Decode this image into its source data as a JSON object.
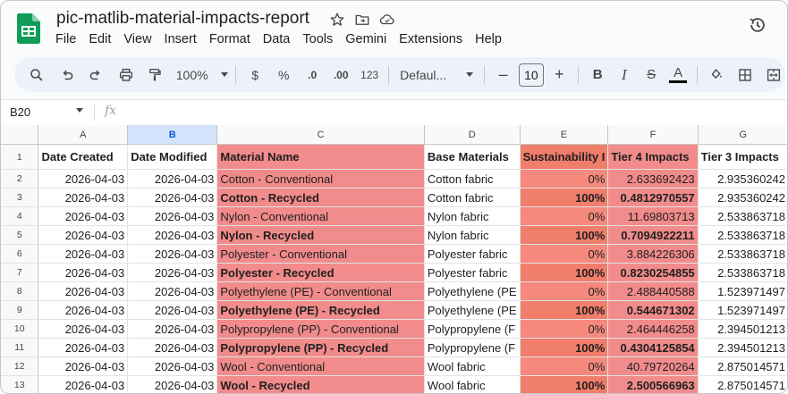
{
  "document": {
    "title": "pic-matlib-material-impacts-report"
  },
  "menu": [
    "File",
    "Edit",
    "View",
    "Insert",
    "Format",
    "Data",
    "Tools",
    "Gemini",
    "Extensions",
    "Help"
  ],
  "toolbar": {
    "zoom": "100%",
    "currency": "$",
    "percent": "%",
    "decrease_decimals": ".0",
    "increase_decimals": ".00",
    "number_format": "123",
    "font": "Defaul...",
    "font_size": "10",
    "minus": "–",
    "plus": "+",
    "bold": "B",
    "italic": "I",
    "strike": "S",
    "text_color": "A"
  },
  "formula_bar": {
    "cell_ref": "B20",
    "fx": "fx"
  },
  "columns": [
    "A",
    "B",
    "C",
    "D",
    "E",
    "F",
    "G"
  ],
  "header_row": {
    "number": "1",
    "cells": [
      "Date Created",
      "Date Modified",
      "Material Name",
      "Base Materials",
      "Sustainability I",
      "Tier 4 Impacts",
      "Tier 3 Impacts"
    ]
  },
  "rows": [
    {
      "n": "2",
      "a": "2026-04-03",
      "b": "2026-04-03",
      "c": "Cotton - Conventional",
      "d": "Cotton fabric",
      "e": "0%",
      "f": "2.633692423",
      "g": "2.935360242",
      "bold": false
    },
    {
      "n": "3",
      "a": "2026-04-03",
      "b": "2026-04-03",
      "c": "Cotton - Recycled",
      "d": "Cotton fabric",
      "e": "100%",
      "f": "0.4812970557",
      "g": "2.935360242",
      "bold": true
    },
    {
      "n": "4",
      "a": "2026-04-03",
      "b": "2026-04-03",
      "c": "Nylon - Conventional",
      "d": "Nylon fabric",
      "e": "0%",
      "f": "11.69803713",
      "g": "2.533863718",
      "bold": false
    },
    {
      "n": "5",
      "a": "2026-04-03",
      "b": "2026-04-03",
      "c": "Nylon - Recycled",
      "d": "Nylon fabric",
      "e": "100%",
      "f": "0.7094922211",
      "g": "2.533863718",
      "bold": true
    },
    {
      "n": "6",
      "a": "2026-04-03",
      "b": "2026-04-03",
      "c": "Polyester - Conventional",
      "d": "Polyester fabric",
      "e": "0%",
      "f": "3.884226306",
      "g": "2.533863718",
      "bold": false
    },
    {
      "n": "7",
      "a": "2026-04-03",
      "b": "2026-04-03",
      "c": "Polyester - Recycled",
      "d": "Polyester fabric",
      "e": "100%",
      "f": "0.8230254855",
      "g": "2.533863718",
      "bold": true
    },
    {
      "n": "8",
      "a": "2026-04-03",
      "b": "2026-04-03",
      "c": "Polyethylene (PE) - Conventional",
      "d": "Polyethylene (PE",
      "e": "0%",
      "f": "2.488440588",
      "g": "1.523971497",
      "bold": false
    },
    {
      "n": "9",
      "a": "2026-04-03",
      "b": "2026-04-03",
      "c": "Polyethylene (PE) - Recycled",
      "d": "Polyethylene (PE",
      "e": "100%",
      "f": "0.544671302",
      "g": "1.523971497",
      "bold": true
    },
    {
      "n": "10",
      "a": "2026-04-03",
      "b": "2026-04-03",
      "c": "Polypropylene (PP) - Conventional",
      "d": "Polypropylene (F",
      "e": "0%",
      "f": "2.464446258",
      "g": "2.394501213",
      "bold": false
    },
    {
      "n": "11",
      "a": "2026-04-03",
      "b": "2026-04-03",
      "c": "Polypropylene (PP) - Recycled",
      "d": "Polypropylene (F",
      "e": "100%",
      "f": "0.4304125854",
      "g": "2.394501213",
      "bold": true
    },
    {
      "n": "12",
      "a": "2026-04-03",
      "b": "2026-04-03",
      "c": "Wool - Conventional",
      "d": "Wool fabric",
      "e": "0%",
      "f": "40.79720264",
      "g": "2.875014571",
      "bold": false
    },
    {
      "n": "13",
      "a": "2026-04-03",
      "b": "2026-04-03",
      "c": "Wool - Recycled",
      "d": "Wool fabric",
      "e": "100%",
      "f": "2.500566963",
      "g": "2.875014571",
      "bold": true
    }
  ],
  "colors": {
    "highlight_red": "#f28b8b",
    "selected_column": "#d3e3fd",
    "sheets_green": "#0f9d58"
  }
}
